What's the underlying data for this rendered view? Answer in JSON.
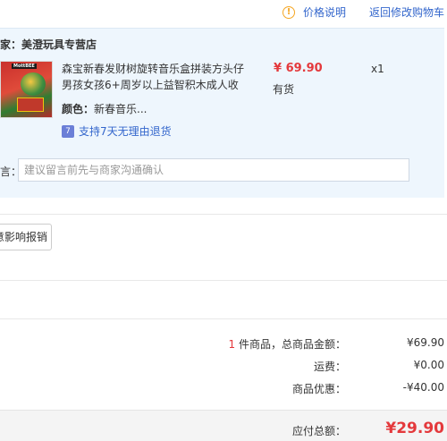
{
  "header": {
    "price_note_label": "价格说明",
    "back_link_label": "返回修改购物车"
  },
  "shop": {
    "merchant_label": "商家：",
    "merchant_name": "美澄玩具专营店"
  },
  "product": {
    "title": "森宝新春发财树旋转音乐盒拼装方头仔男孩女孩6+周岁以上益智积木成人收",
    "price": "¥ 69.90",
    "stock": "有货",
    "quantity": "x1",
    "color_label": "颜色：",
    "color_value": "新春音乐...",
    "return_policy": "支持7天无理由退货",
    "image_brand_text": "MottBEE"
  },
  "message": {
    "label": "留言：",
    "placeholder": "建议留言前先与商家沟通确认"
  },
  "report_button": {
    "label": "意影响报销"
  },
  "summary": {
    "count": "1",
    "count_label": "件商品，总商品金额：",
    "goods_total": "¥69.90",
    "shipping_label": "运费：",
    "shipping": "¥0.00",
    "discount_label": "商品优惠：",
    "discount": "-¥40.00"
  },
  "total": {
    "label": "应付总额：",
    "value": "¥29.90"
  },
  "colors": {
    "accent_red": "#e4393c",
    "link_blue": "#3366cc",
    "panel_bg": "#eef6fd",
    "info_orange": "#f5a623"
  }
}
